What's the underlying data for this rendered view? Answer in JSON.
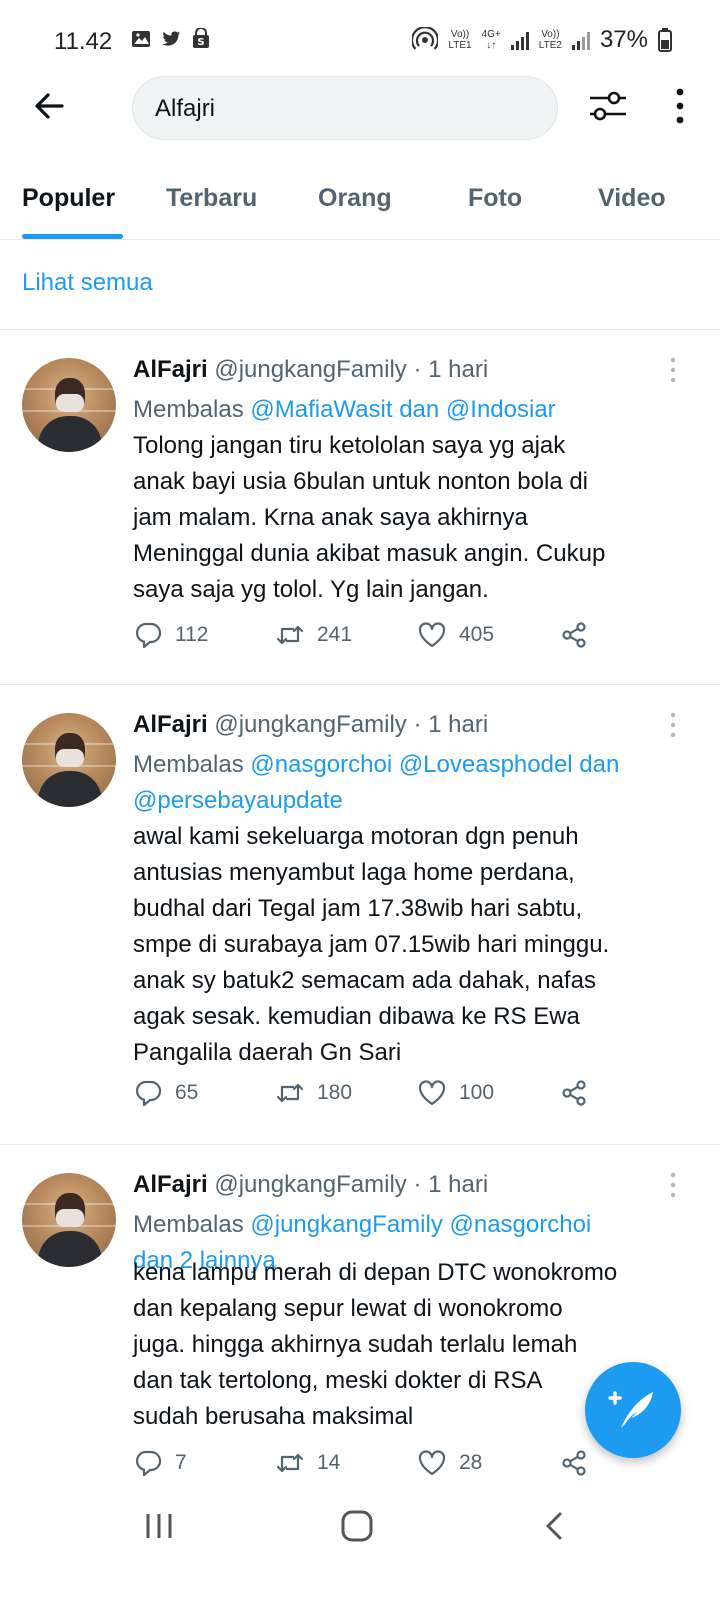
{
  "status_bar": {
    "time": "11.42",
    "sim1_label_top": "Vo))",
    "sim1_label_bottom": "LTE1",
    "network_label_top": "4G+",
    "network_label_bottom": "↓↑",
    "sim2_label_top": "Vo))",
    "sim2_label_bottom": "LTE2",
    "battery": "37%"
  },
  "search": {
    "query": "Alfajri"
  },
  "tabs": [
    {
      "label": "Populer"
    },
    {
      "label": "Terbaru"
    },
    {
      "label": "Orang"
    },
    {
      "label": "Foto"
    },
    {
      "label": "Video"
    }
  ],
  "see_all": "Lihat semua",
  "tweets": [
    {
      "name": "AlFajri",
      "handle": "@jungkangFamily",
      "time": "· 1 hari",
      "reply_prefix": "Membalas ",
      "reply_mentions": "@MafiaWasit dan @Indosiar",
      "reply_mentions_line2": "",
      "text_lines": [
        "Tolong jangan tiru ketololan saya yg ajak",
        "anak bayi usia 6bulan untuk nonton bola di",
        "jam malam. Krna anak saya akhirnya",
        "Meninggal dunia akibat masuk angin. Cukup",
        "saya saja yg tolol. Yg lain jangan."
      ],
      "replies": "112",
      "retweets": "241",
      "likes": "405"
    },
    {
      "name": "AlFajri",
      "handle": "@jungkangFamily",
      "time": "· 1 hari",
      "reply_prefix": "Membalas ",
      "reply_mentions": "@nasgorchoi @Loveasphodel dan",
      "reply_mentions_line2": "@persebayaupdate",
      "text_lines": [
        "awal kami sekeluarga motoran dgn penuh",
        "antusias menyambut laga home perdana,",
        "budhal dari Tegal jam 17.38wib hari sabtu,",
        "smpe di surabaya jam 07.15wib hari minggu.",
        "anak sy batuk2 semacam ada dahak, nafas",
        "agak sesak. kemudian dibawa ke RS Ewa",
        "Pangalila daerah Gn Sari"
      ],
      "replies": "65",
      "retweets": "180",
      "likes": "100"
    },
    {
      "name": "AlFajri",
      "handle": "@jungkangFamily",
      "time": "· 1 hari",
      "reply_prefix": "Membalas ",
      "reply_mentions": "@jungkangFamily @nasgorchoi",
      "reply_mentions_line2": "dan 2 lainnya",
      "text_lines": [
        "kena lampu merah di depan DTC wonokromo",
        "dan kepalang sepur lewat di wonokromo",
        "juga. hingga akhirnya sudah terlalu lemah",
        "dan tak tertolong, meski dokter di RSA",
        "sudah berusaha maksimal"
      ],
      "replies": "7",
      "retweets": "14",
      "likes": "28"
    }
  ],
  "colors": {
    "accent": "#1d9bf0",
    "text_primary": "#0f1419",
    "text_secondary": "#536471"
  }
}
